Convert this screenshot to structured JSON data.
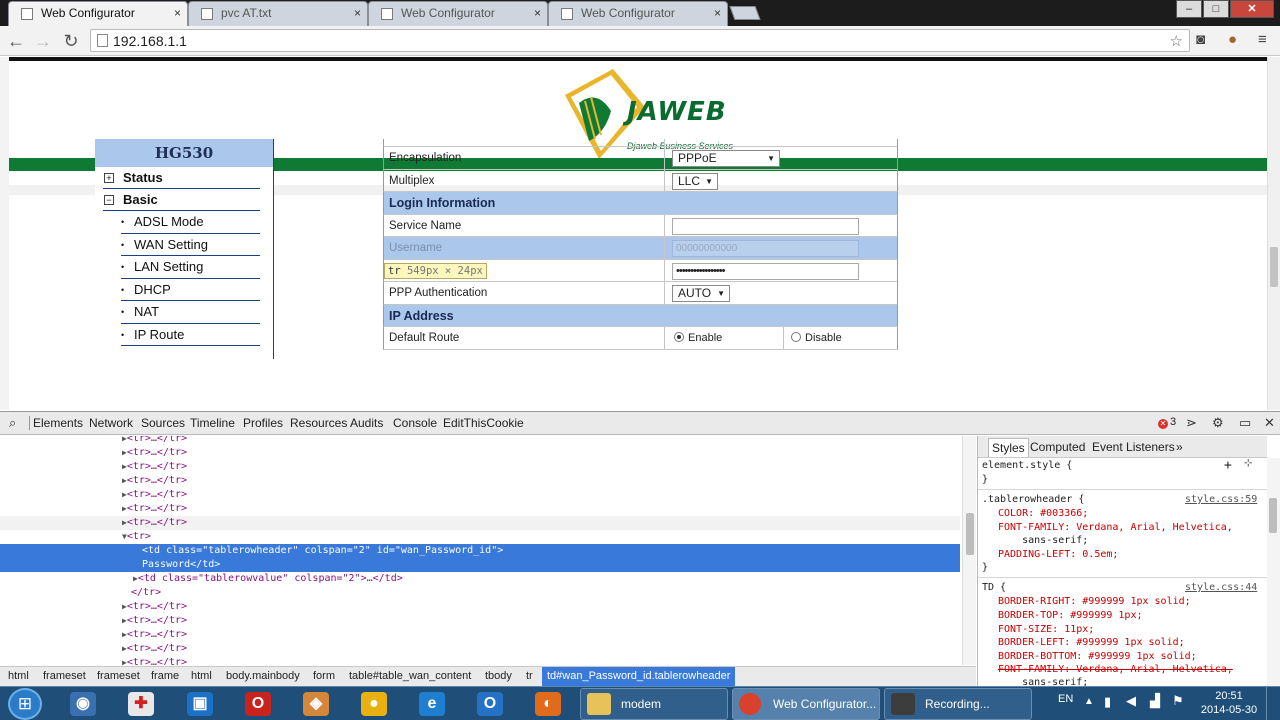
{
  "browser": {
    "tabs": [
      {
        "title": "Web Configurator",
        "active": true
      },
      {
        "title": "pvc AT.txt",
        "active": false
      },
      {
        "title": "Web Configurator",
        "active": false
      },
      {
        "title": "Web Configurator",
        "active": false
      }
    ],
    "tab_close": "×",
    "url": "192.168.1.1",
    "window": {
      "minimize": "–",
      "maximize": "□",
      "close": "✕"
    }
  },
  "logo": {
    "name": "JAWEB",
    "subtitle": "Djaweb Business Services"
  },
  "sidebar": {
    "model": "HG530",
    "groups": [
      {
        "label": "Status",
        "toggle": "+"
      },
      {
        "label": "Basic",
        "toggle": "−"
      }
    ],
    "items": [
      "ADSL Mode",
      "WAN Setting",
      "LAN Setting",
      "DHCP",
      "NAT",
      "IP Route"
    ]
  },
  "form": {
    "encapsulation": {
      "label": "Encapsulation",
      "value": "PPPoE"
    },
    "multiplex": {
      "label": "Multiplex",
      "value": "LLC"
    },
    "login_section": "Login Information",
    "service_name": {
      "label": "Service Name",
      "value": ""
    },
    "username": {
      "label": "Username",
      "value": "00000000000"
    },
    "password": {
      "value": "•••••••••••••••••"
    },
    "ppp_auth": {
      "label": "PPP Authentication",
      "value": "AUTO"
    },
    "ip_section": "IP Address",
    "default_route": {
      "label": "Default Route",
      "enable": "Enable",
      "disable": "Disable",
      "selected": "Enable"
    }
  },
  "inspect_tooltip": {
    "tag": "tr",
    "size": "549px × 24px"
  },
  "devtools": {
    "tabs": [
      "Elements",
      "Network",
      "Sources",
      "Timeline",
      "Profiles",
      "Resources",
      "Audits",
      "Console",
      "EditThisCookie"
    ],
    "active_tab": "Elements",
    "error_count": "3",
    "dom": {
      "collapsed_row": "<tr>…</tr>",
      "open_row": "<tr>",
      "selected_line1": "<td class=\"tablerowheader\" colspan=\"2\" id=\"wan_Password_id\">",
      "selected_line2": "Password</td>",
      "value_cell": "<td class=\"tablerowvalue\" colspan=\"2\">…</td>",
      "close_row": "</tr>"
    },
    "styles_tabs": [
      "Styles",
      "Computed",
      "Event Listeners"
    ],
    "styles": {
      "element_style": "element.style {",
      "close_brace": "}",
      "rule1_selector": ".tablerowheader {",
      "rule1_source": "style.css:59",
      "rule1_props": [
        "COLOR: #003366;",
        "FONT-FAMILY: Verdana, Arial, Helvetica,",
        "    sans-serif;",
        "PADDING-LEFT: 0.5em;"
      ],
      "rule2_selector": "TD {",
      "rule2_source": "style.css:44",
      "rule2_props": [
        "BORDER-RIGHT: #999999 1px solid;",
        "BORDER-TOP: #999999 1px;",
        "FONT-SIZE: 11px;",
        "BORDER-LEFT: #999999 1px solid;",
        "BORDER-BOTTOM: #999999 1px solid;",
        "FONT-FAMILY: Verdana, Arial, Helvetica,",
        "    sans-serif;"
      ]
    },
    "breadcrumbs": [
      "html",
      "frameset",
      "frameset",
      "frame",
      "html",
      "body.mainbody",
      "form",
      "table#table_wan_content",
      "tbody",
      "tr",
      "td#wan_Password_id.tablerowheader"
    ]
  },
  "taskbar": {
    "tasks": [
      {
        "label": "modem",
        "active": false
      },
      {
        "label": "Web Configurator...",
        "active": true
      },
      {
        "label": "Recording...",
        "active": false
      }
    ],
    "language": "EN",
    "time": "20:51",
    "date": "2014-05-30"
  },
  "colors": {
    "brand_green": "#0f7a33",
    "header_blue": "#abc8ec",
    "selection_blue": "#3879d9"
  }
}
